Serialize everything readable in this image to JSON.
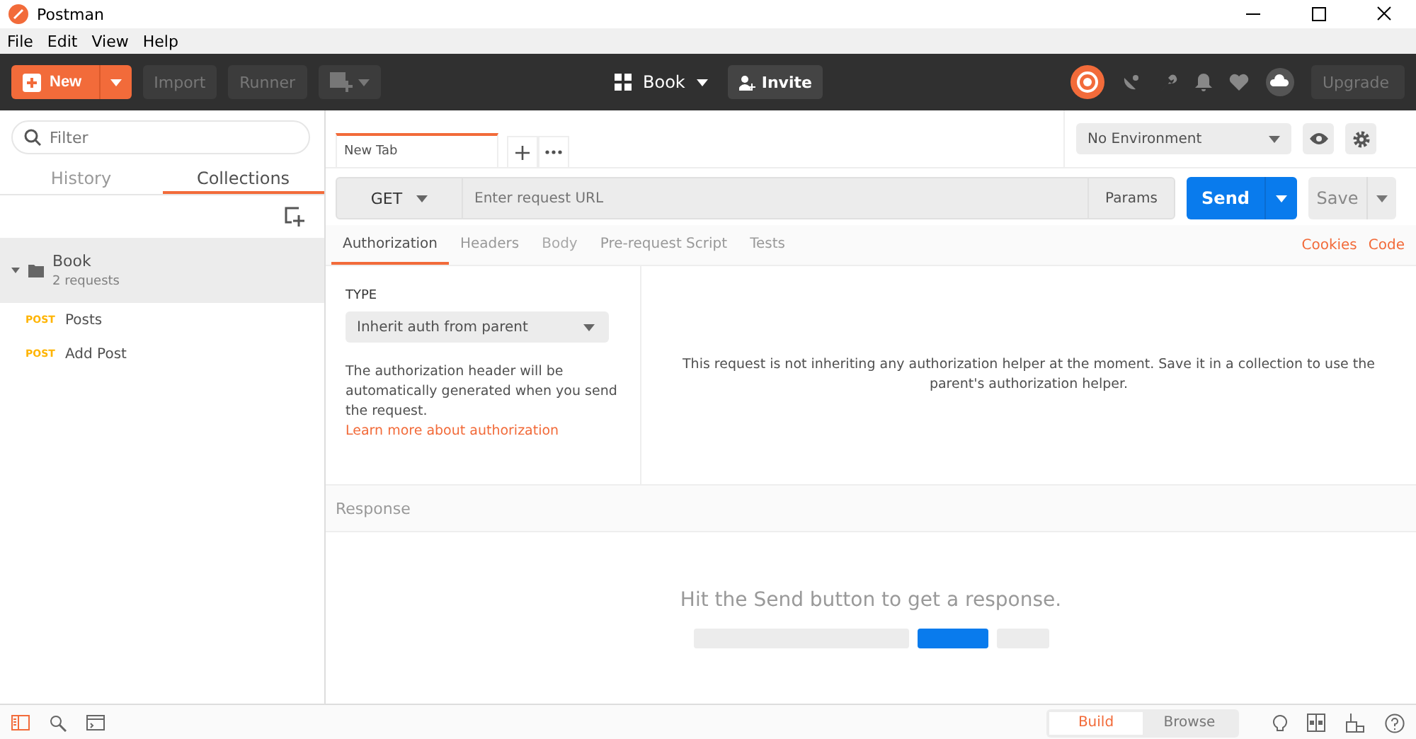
{
  "window": {
    "title": "Postman"
  },
  "menu": [
    "File",
    "Edit",
    "View",
    "Help"
  ],
  "toolbar": {
    "new": "New",
    "buttons": [
      "Import",
      "Runner"
    ],
    "workspace": "Book",
    "invite": "Invite",
    "upgrade": "Upgrade"
  },
  "sidebar": {
    "filter_placeholder": "Filter",
    "tabs": [
      {
        "label": "History",
        "selected": false
      },
      {
        "label": "Collections",
        "selected": true
      }
    ],
    "collections": [
      {
        "name": "Book",
        "count": "2 requests",
        "expanded": true,
        "selected": true,
        "children": [
          {
            "method": "POST",
            "name": "Posts"
          },
          {
            "method": "POST",
            "name": "Add Post"
          }
        ]
      }
    ]
  },
  "environment": {
    "value": "No Environment"
  },
  "request_tabs": [
    {
      "label": "New Tab",
      "selected": true
    }
  ],
  "request": {
    "method": "GET",
    "url_placeholder": "Enter request URL",
    "params": "Params",
    "send": "Send",
    "save": "Save"
  },
  "request_sections": [
    {
      "label": "Authorization",
      "selected": true,
      "disabled": false
    },
    {
      "label": "Headers",
      "selected": false,
      "disabled": false
    },
    {
      "label": "Body",
      "selected": false,
      "disabled": true
    },
    {
      "label": "Pre-request Script",
      "selected": false,
      "disabled": false
    },
    {
      "label": "Tests",
      "selected": false,
      "disabled": false
    }
  ],
  "links": [
    "Cookies",
    "Code"
  ],
  "auth": {
    "type_label": "TYPE",
    "type_value": "Inherit auth from parent",
    "description": "The authorization header will be automatically generated when you send the request.",
    "learn_more": "Learn more about authorization",
    "message": "This request is not inheriting any authorization helper at the moment. Save it in a collection to use the parent's authorization helper."
  },
  "response": {
    "title": "Response",
    "hint": "Hit the Send button to get a response."
  },
  "status_bar": {
    "modes": [
      {
        "label": "Build",
        "selected": true
      },
      {
        "label": "Browse",
        "selected": false
      }
    ]
  }
}
